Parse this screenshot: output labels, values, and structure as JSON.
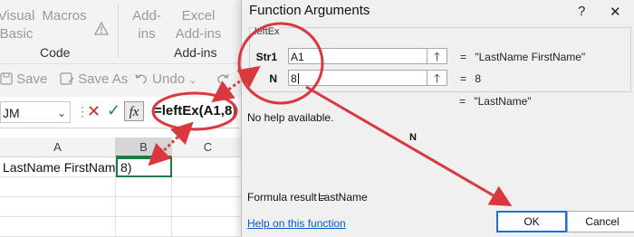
{
  "excel": {
    "ribbon": {
      "visual_basic": [
        "Visual",
        "Basic"
      ],
      "macros": "Macros",
      "group_code": "Code",
      "addins_btn": [
        "Add-",
        "ins"
      ],
      "excel_addins": [
        "Excel",
        "Add-ins"
      ],
      "group_addins": "Add-ins"
    },
    "qat": {
      "save": "Save",
      "save_as": "Save As",
      "undo": "Undo"
    },
    "namebox": "JM",
    "fx": "fx",
    "formula": "=leftEx(A1,8)",
    "columns": [
      "A",
      "B",
      "C"
    ],
    "cells": {
      "a1": "LastName FirstName",
      "b1": "8)"
    }
  },
  "dialog": {
    "title": "Function Arguments",
    "help_glyph": "?",
    "close_glyph": "✕",
    "function_name": "leftEx",
    "args": [
      {
        "label": "Str1",
        "value": "A1",
        "result": "\"LastName FirstName\""
      },
      {
        "label": "N",
        "value": "8",
        "result": "8"
      }
    ],
    "equals": "=",
    "overall_result": "\"LastName\"",
    "description": "No help available.",
    "param_desc": "N",
    "formula_result_label": "Formula result =",
    "formula_result_value": "LastName",
    "help_link": "Help on this function",
    "ok": "OK",
    "cancel": "Cancel",
    "collapse_glyph": "🡑"
  },
  "colors": {
    "annotation_red": "#d9393e",
    "ok_border": "#1e6fd9",
    "link": "#0a58ca",
    "cell_border_green": "#1f7a43"
  }
}
